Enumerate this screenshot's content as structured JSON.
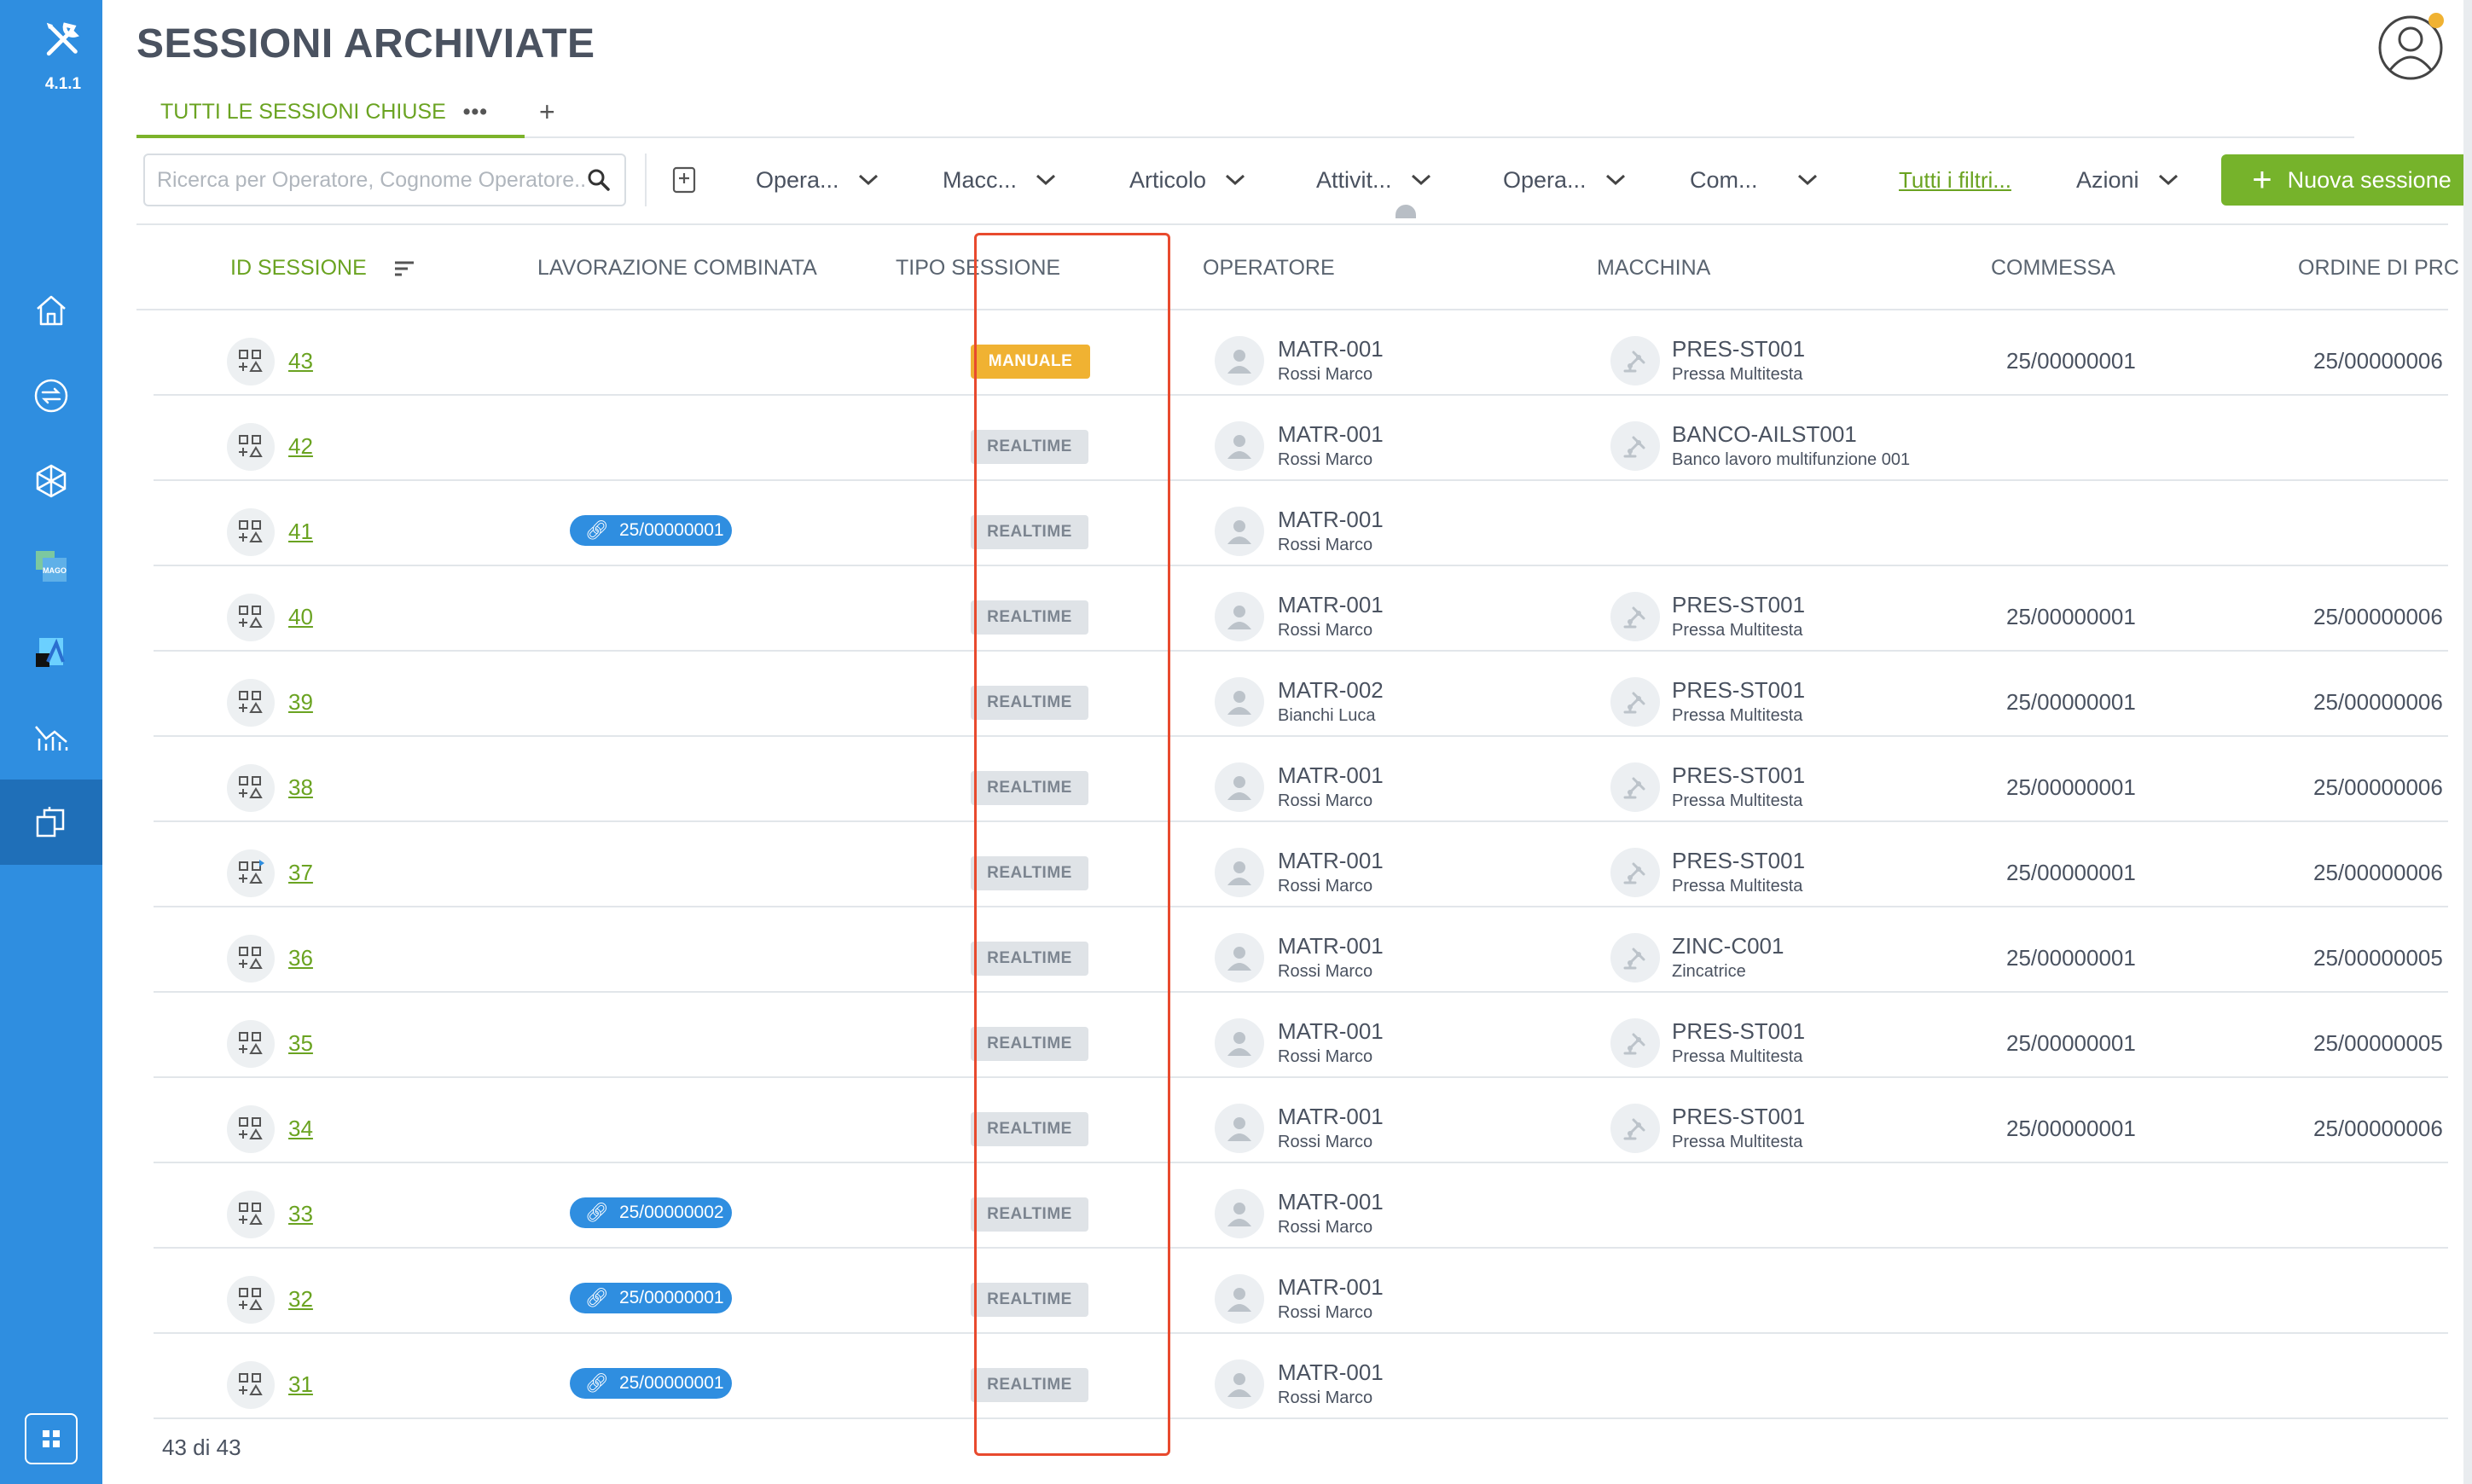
{
  "app": {
    "version": "4.1.1"
  },
  "sidebar": {
    "items": [
      {
        "icon": "home-icon"
      },
      {
        "icon": "transfer-icon"
      },
      {
        "icon": "cube-icon"
      },
      {
        "icon": "mago-icon",
        "label": "MAGO"
      },
      {
        "icon": "app-icon"
      },
      {
        "icon": "chart-icon"
      },
      {
        "icon": "sessions-icon",
        "active": true
      }
    ],
    "bottom_icon": "apps-grid-icon"
  },
  "page": {
    "title": "SESSIONI ARCHIVIATE"
  },
  "tabs": [
    {
      "label": "TUTTI LE SESSIONI CHIUSE",
      "menu": "•••"
    }
  ],
  "tab_add": "+",
  "toolbar": {
    "search_placeholder": "Ricerca per Operatore, Cognome Operatore...",
    "filters": [
      "Opera...",
      "Macc...",
      "Articolo",
      "Attivit...",
      "Opera...",
      "Com..."
    ],
    "all_filters": "Tutti i filtri...",
    "actions": "Azioni",
    "new_session": "Nuova sessione"
  },
  "table": {
    "columns": [
      "ID SESSIONE",
      "LAVORAZIONE COMBINATA",
      "TIPO SESSIONE",
      "OPERATORE",
      "MACCHINA",
      "COMMESSA",
      "ORDINE DI PRC"
    ],
    "rows": [
      {
        "id": "43",
        "combo": "",
        "type": "MANUALE",
        "op_code": "MATR-001",
        "op_name": "Rossi Marco",
        "m_code": "PRES-ST001",
        "m_name": "Pressa Multitesta",
        "comm": "25/00000001",
        "ord": "25/00000006"
      },
      {
        "id": "42",
        "combo": "",
        "type": "REALTIME",
        "op_code": "MATR-001",
        "op_name": "Rossi Marco",
        "m_code": "BANCO-AILST001",
        "m_name": "Banco lavoro multifunzione 001",
        "comm": "",
        "ord": ""
      },
      {
        "id": "41",
        "combo": "25/00000001",
        "type": "REALTIME",
        "op_code": "MATR-001",
        "op_name": "Rossi Marco",
        "m_code": "",
        "m_name": "",
        "comm": "",
        "ord": ""
      },
      {
        "id": "40",
        "combo": "",
        "type": "REALTIME",
        "op_code": "MATR-001",
        "op_name": "Rossi Marco",
        "m_code": "PRES-ST001",
        "m_name": "Pressa Multitesta",
        "comm": "25/00000001",
        "ord": "25/00000006"
      },
      {
        "id": "39",
        "combo": "",
        "type": "REALTIME",
        "op_code": "MATR-002",
        "op_name": "Bianchi Luca",
        "m_code": "PRES-ST001",
        "m_name": "Pressa Multitesta",
        "comm": "25/00000001",
        "ord": "25/00000006"
      },
      {
        "id": "38",
        "combo": "",
        "type": "REALTIME",
        "op_code": "MATR-001",
        "op_name": "Rossi Marco",
        "m_code": "PRES-ST001",
        "m_name": "Pressa Multitesta",
        "comm": "25/00000001",
        "ord": "25/00000006"
      },
      {
        "id": "37",
        "combo": "",
        "type": "REALTIME",
        "op_code": "MATR-001",
        "op_name": "Rossi Marco",
        "m_code": "PRES-ST001",
        "m_name": "Pressa Multitesta",
        "comm": "25/00000001",
        "ord": "25/00000006",
        "flag": true
      },
      {
        "id": "36",
        "combo": "",
        "type": "REALTIME",
        "op_code": "MATR-001",
        "op_name": "Rossi Marco",
        "m_code": "ZINC-C001",
        "m_name": "Zincatrice",
        "comm": "25/00000001",
        "ord": "25/00000005"
      },
      {
        "id": "35",
        "combo": "",
        "type": "REALTIME",
        "op_code": "MATR-001",
        "op_name": "Rossi Marco",
        "m_code": "PRES-ST001",
        "m_name": "Pressa Multitesta",
        "comm": "25/00000001",
        "ord": "25/00000005"
      },
      {
        "id": "34",
        "combo": "",
        "type": "REALTIME",
        "op_code": "MATR-001",
        "op_name": "Rossi Marco",
        "m_code": "PRES-ST001",
        "m_name": "Pressa Multitesta",
        "comm": "25/00000001",
        "ord": "25/00000006"
      },
      {
        "id": "33",
        "combo": "25/00000002",
        "type": "REALTIME",
        "op_code": "MATR-001",
        "op_name": "Rossi Marco",
        "m_code": "",
        "m_name": "",
        "comm": "",
        "ord": ""
      },
      {
        "id": "32",
        "combo": "25/00000001",
        "type": "REALTIME",
        "op_code": "MATR-001",
        "op_name": "Rossi Marco",
        "m_code": "",
        "m_name": "",
        "comm": "",
        "ord": ""
      },
      {
        "id": "31",
        "combo": "25/00000001",
        "type": "REALTIME",
        "op_code": "MATR-001",
        "op_name": "Rossi Marco",
        "m_code": "",
        "m_name": "",
        "comm": "",
        "ord": ""
      }
    ]
  },
  "footer": {
    "count": "43 di 43"
  },
  "colors": {
    "sidebar": "#2f8ee0",
    "accent": "#76b32b",
    "manual": "#f0b232",
    "highlight": "#e84a2e"
  }
}
